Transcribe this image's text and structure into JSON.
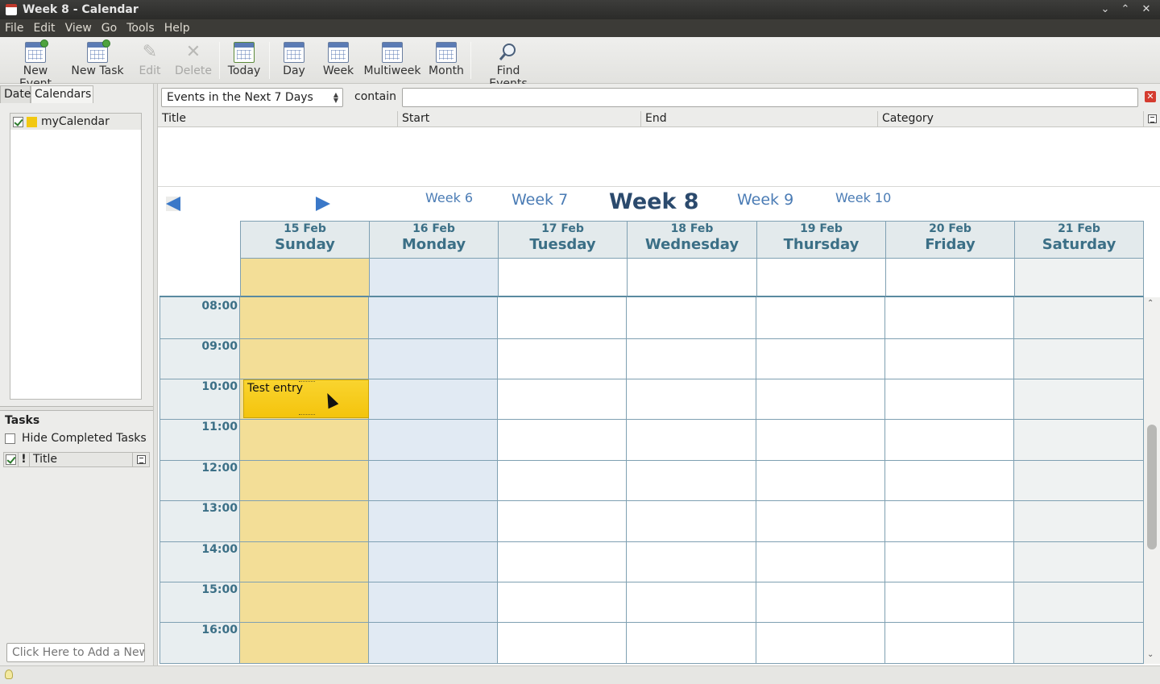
{
  "window": {
    "title": "Week 8 - Calendar",
    "controls": [
      "⌄",
      "⌃",
      "✕"
    ]
  },
  "menubar": {
    "items": [
      {
        "label": "File"
      },
      {
        "label": "Edit"
      },
      {
        "label": "View"
      },
      {
        "label": "Go"
      },
      {
        "label": "Tools"
      },
      {
        "label": "Help"
      }
    ]
  },
  "toolbar": {
    "new_event": "New Event",
    "new_task": "New Task",
    "edit": "Edit",
    "delete": "Delete",
    "today": "Today",
    "day": "Day",
    "week": "Week",
    "multiweek": "Multiweek",
    "month": "Month",
    "find_events": "Find Events"
  },
  "sidebar": {
    "tabs": [
      {
        "label": "Date"
      },
      {
        "label": "Calendars"
      }
    ],
    "calendars": [
      {
        "name": "myCalendar",
        "checked": true,
        "color": "#f2c811"
      }
    ],
    "tasks": {
      "title": "Tasks",
      "hide_completed": "Hide Completed Tasks",
      "col_priority": "!",
      "col_title": "Title",
      "new_task_placeholder": "Click Here to Add a New Task"
    }
  },
  "filter": {
    "selected": "Events in the Next 7 Days",
    "contain_label": "contain",
    "search_value": ""
  },
  "event_list": {
    "columns": [
      "Title",
      "Start",
      "End",
      "Category"
    ]
  },
  "week_nav": {
    "weeks": [
      "Week 6",
      "Week 7",
      "Week 8",
      "Week 9",
      "Week 10"
    ],
    "current": "Week 8"
  },
  "days": [
    {
      "date": "15 Feb",
      "name": "Sunday"
    },
    {
      "date": "16 Feb",
      "name": "Monday"
    },
    {
      "date": "17 Feb",
      "name": "Tuesday"
    },
    {
      "date": "18 Feb",
      "name": "Wednesday"
    },
    {
      "date": "19 Feb",
      "name": "Thursday"
    },
    {
      "date": "20 Feb",
      "name": "Friday"
    },
    {
      "date": "21 Feb",
      "name": "Saturday"
    }
  ],
  "hours": [
    "08:00",
    "09:00",
    "10:00",
    "11:00",
    "12:00",
    "13:00",
    "14:00",
    "15:00",
    "16:00"
  ],
  "events": [
    {
      "title": "Test entry",
      "day": "Sunday",
      "start": "10:00",
      "end": "11:00"
    }
  ],
  "colors": {
    "event": "#f4c40c",
    "today_column": "#f3de97",
    "monday_column": "#e1eaf3",
    "weekend_column": "#eff2f2",
    "header_text": "#3b6f86",
    "accent": "#4b7cb5"
  }
}
